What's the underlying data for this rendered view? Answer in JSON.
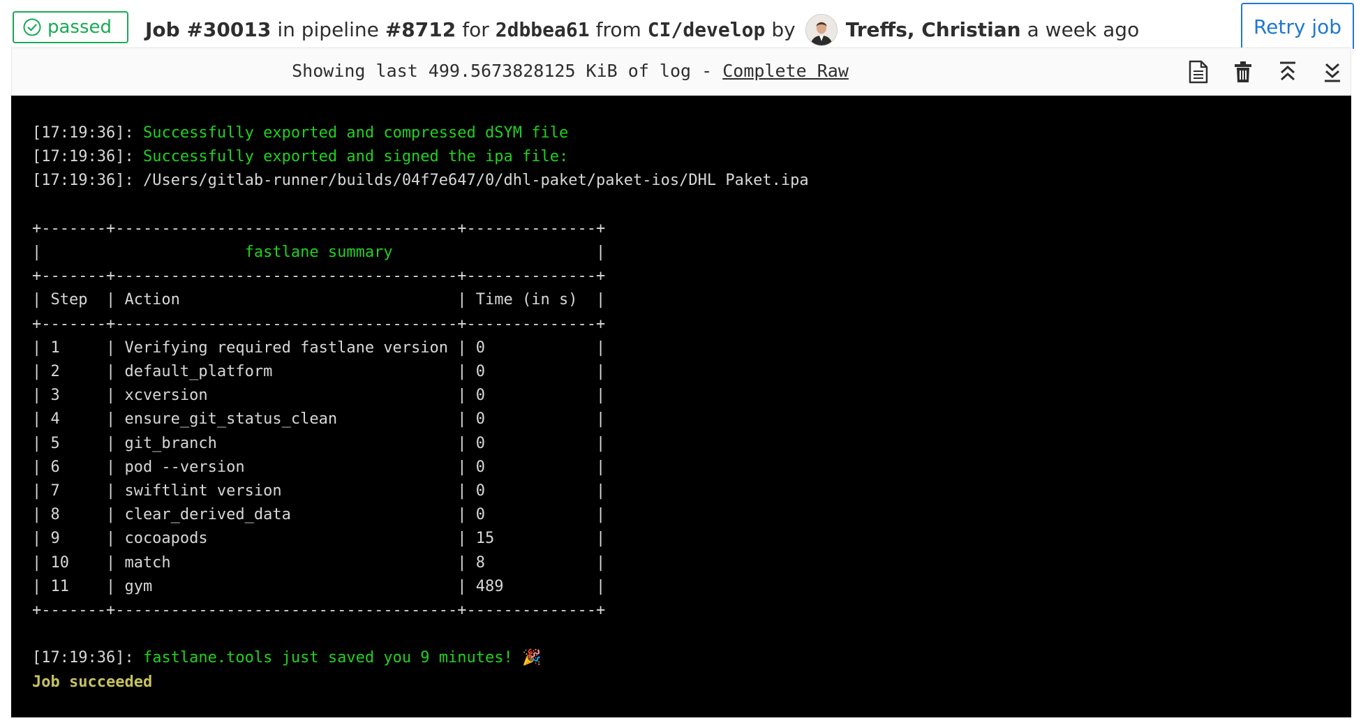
{
  "header": {
    "status": "passed",
    "job_label": "Job #30013",
    "in_pipeline": "in pipeline",
    "pipeline": "#8712",
    "for": "for",
    "commit": "2dbbea61",
    "from": "from",
    "branch": "CI/develop",
    "by": "by",
    "user": "Treffs, Christian",
    "time_ago": "a week ago",
    "retry_label": "Retry job"
  },
  "toolbar": {
    "size_text": "Showing last 499.5673828125 KiB of log -",
    "complete_raw": "Complete Raw",
    "icons": [
      "raw-log-icon",
      "erase-log-icon",
      "scroll-top-icon",
      "scroll-bottom-icon"
    ]
  },
  "log": {
    "lines": [
      {
        "ts": "[17:19:36]: ",
        "text": "Successfully exported and compressed dSYM file"
      },
      {
        "ts": "[17:19:36]: ",
        "text": "Successfully exported and signed the ipa file:"
      },
      {
        "ts": "[17:19:36]: ",
        "text": "/Users/gitlab-runner/builds/04f7e647/0/dhl-paket/paket-ios/DHL Paket.ipa"
      }
    ],
    "summary_title": "fastlane summary",
    "table_headers": [
      "Step",
      "Action",
      "Time (in s)"
    ],
    "table_rows": [
      [
        "1",
        "Verifying required fastlane version",
        "0"
      ],
      [
        "2",
        "default_platform",
        "0"
      ],
      [
        "3",
        "xcversion",
        "0"
      ],
      [
        "4",
        "ensure_git_status_clean",
        "0"
      ],
      [
        "5",
        "git_branch",
        "0"
      ],
      [
        "6",
        "pod --version",
        "0"
      ],
      [
        "7",
        "swiftlint version",
        "0"
      ],
      [
        "8",
        "clear_derived_data",
        "0"
      ],
      [
        "9",
        "cocoapods",
        "15"
      ],
      [
        "10",
        "match",
        "8"
      ],
      [
        "11",
        "gym",
        "489"
      ]
    ],
    "saved_ts": "[17:19:36]: ",
    "saved_text": "fastlane.tools just saved you 9 minutes! 🎉",
    "job_succeeded": "Job succeeded"
  },
  "colors": {
    "success": "#1aaa55",
    "primary": "#1f78d1",
    "log_green": "#21d120",
    "log_yellow": "#c7c260"
  }
}
